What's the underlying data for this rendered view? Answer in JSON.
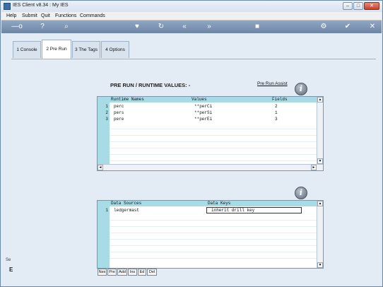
{
  "window": {
    "title": "IES Client v8.34 : My IES",
    "controls": [
      "–",
      "□",
      "✕"
    ]
  },
  "menu": [
    "Help",
    "Submit",
    "Quit",
    "Functions",
    "Commands"
  ],
  "toolbar": {
    "icons": [
      "key-icon",
      "help-icon",
      "search-icon",
      "heart-icon",
      "refresh-icon",
      "rewind-icon",
      "fast-forward-icon",
      "stop-icon",
      "settings-icon",
      "check-icon",
      "close-icon"
    ],
    "glyphs": [
      "—o",
      "?",
      "⌕",
      "♥",
      "↻",
      "«",
      "»",
      "■",
      "⚙",
      "✔",
      "✕"
    ]
  },
  "tabs": [
    {
      "label": "1 Console",
      "active": false
    },
    {
      "label": "2 Pre Run",
      "active": true
    },
    {
      "label": "3 The Tags",
      "active": false
    },
    {
      "label": "4 Options",
      "active": false
    }
  ],
  "section": {
    "title": "PRE RUN / RUNTIME VALUES: -",
    "assist_link": "Pre Run Assist"
  },
  "runtime_grid": {
    "columns": [
      "Runtime Names",
      "Values",
      "Fields"
    ],
    "rows": [
      {
        "num": "1",
        "name": "perc",
        "value": "**perCi",
        "field": "2"
      },
      {
        "num": "2",
        "name": "pers",
        "value": "**perSi",
        "field": "1"
      },
      {
        "num": "3",
        "name": "pere",
        "value": "**perEi",
        "field": "3"
      }
    ]
  },
  "datasource_grid": {
    "columns": [
      "Data Sources",
      "Data Keys"
    ],
    "rows": [
      {
        "num": "1",
        "source": "ledgermast",
        "key": "inherit drill key"
      }
    ]
  },
  "bottom_buttons": [
    "Nex",
    "Pre",
    "Add",
    "Ins",
    "Ed",
    "Del"
  ],
  "side_fragments": [
    "Se",
    "E"
  ],
  "info_icon": "i",
  "scroll_glyphs": {
    "up": "▲",
    "down": "▼",
    "left": "◄",
    "right": "►"
  }
}
